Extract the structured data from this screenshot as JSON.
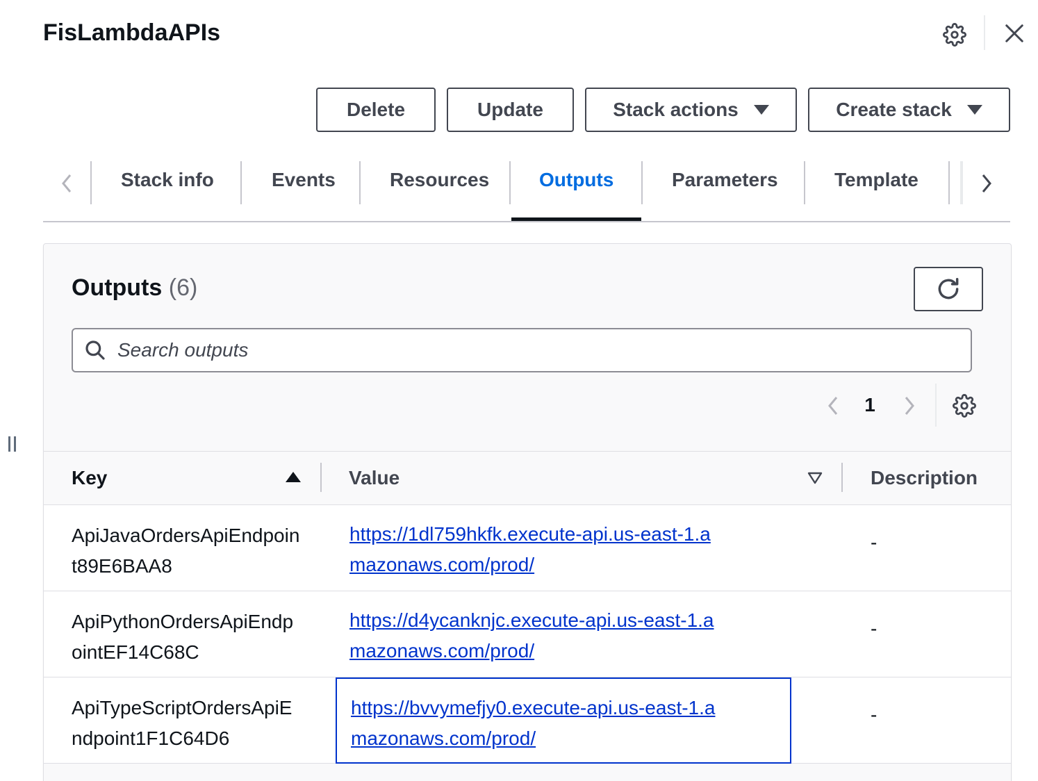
{
  "header": {
    "title": "FisLambdaAPIs"
  },
  "actions": {
    "delete_label": "Delete",
    "update_label": "Update",
    "stack_actions_label": "Stack actions",
    "create_stack_label": "Create stack"
  },
  "tabs": [
    {
      "label": "Stack info"
    },
    {
      "label": "Events"
    },
    {
      "label": "Resources"
    },
    {
      "label": "Outputs",
      "active": true
    },
    {
      "label": "Parameters"
    },
    {
      "label": "Template"
    }
  ],
  "outputs": {
    "title": "Outputs",
    "count": "(6)",
    "search_placeholder": "Search outputs",
    "current_page": "1",
    "columns": {
      "key": "Key",
      "value": "Value",
      "description": "Description"
    },
    "rows": [
      {
        "key": "ApiJavaOrdersApiEndpoint89E6BAA8",
        "value": "https://1dl759hkfk.execute-api.us-east-1.amazonaws.com/prod/",
        "description": "-"
      },
      {
        "key": "ApiPythonOrdersApiEndpointEF14C68C",
        "value": "https://d4ycanknjc.execute-api.us-east-1.amazonaws.com/prod/",
        "description": "-"
      },
      {
        "key": "ApiTypeScriptOrdersApiEndpoint1F1C64D6",
        "value": "https://bvvymefjy0.execute-api.us-east-1.amazonaws.com/prod/",
        "description": "-"
      }
    ]
  },
  "colors": {
    "accent": "#006ce0",
    "link": "#0033cc",
    "text": "#0f141a",
    "secondary": "#424650"
  }
}
